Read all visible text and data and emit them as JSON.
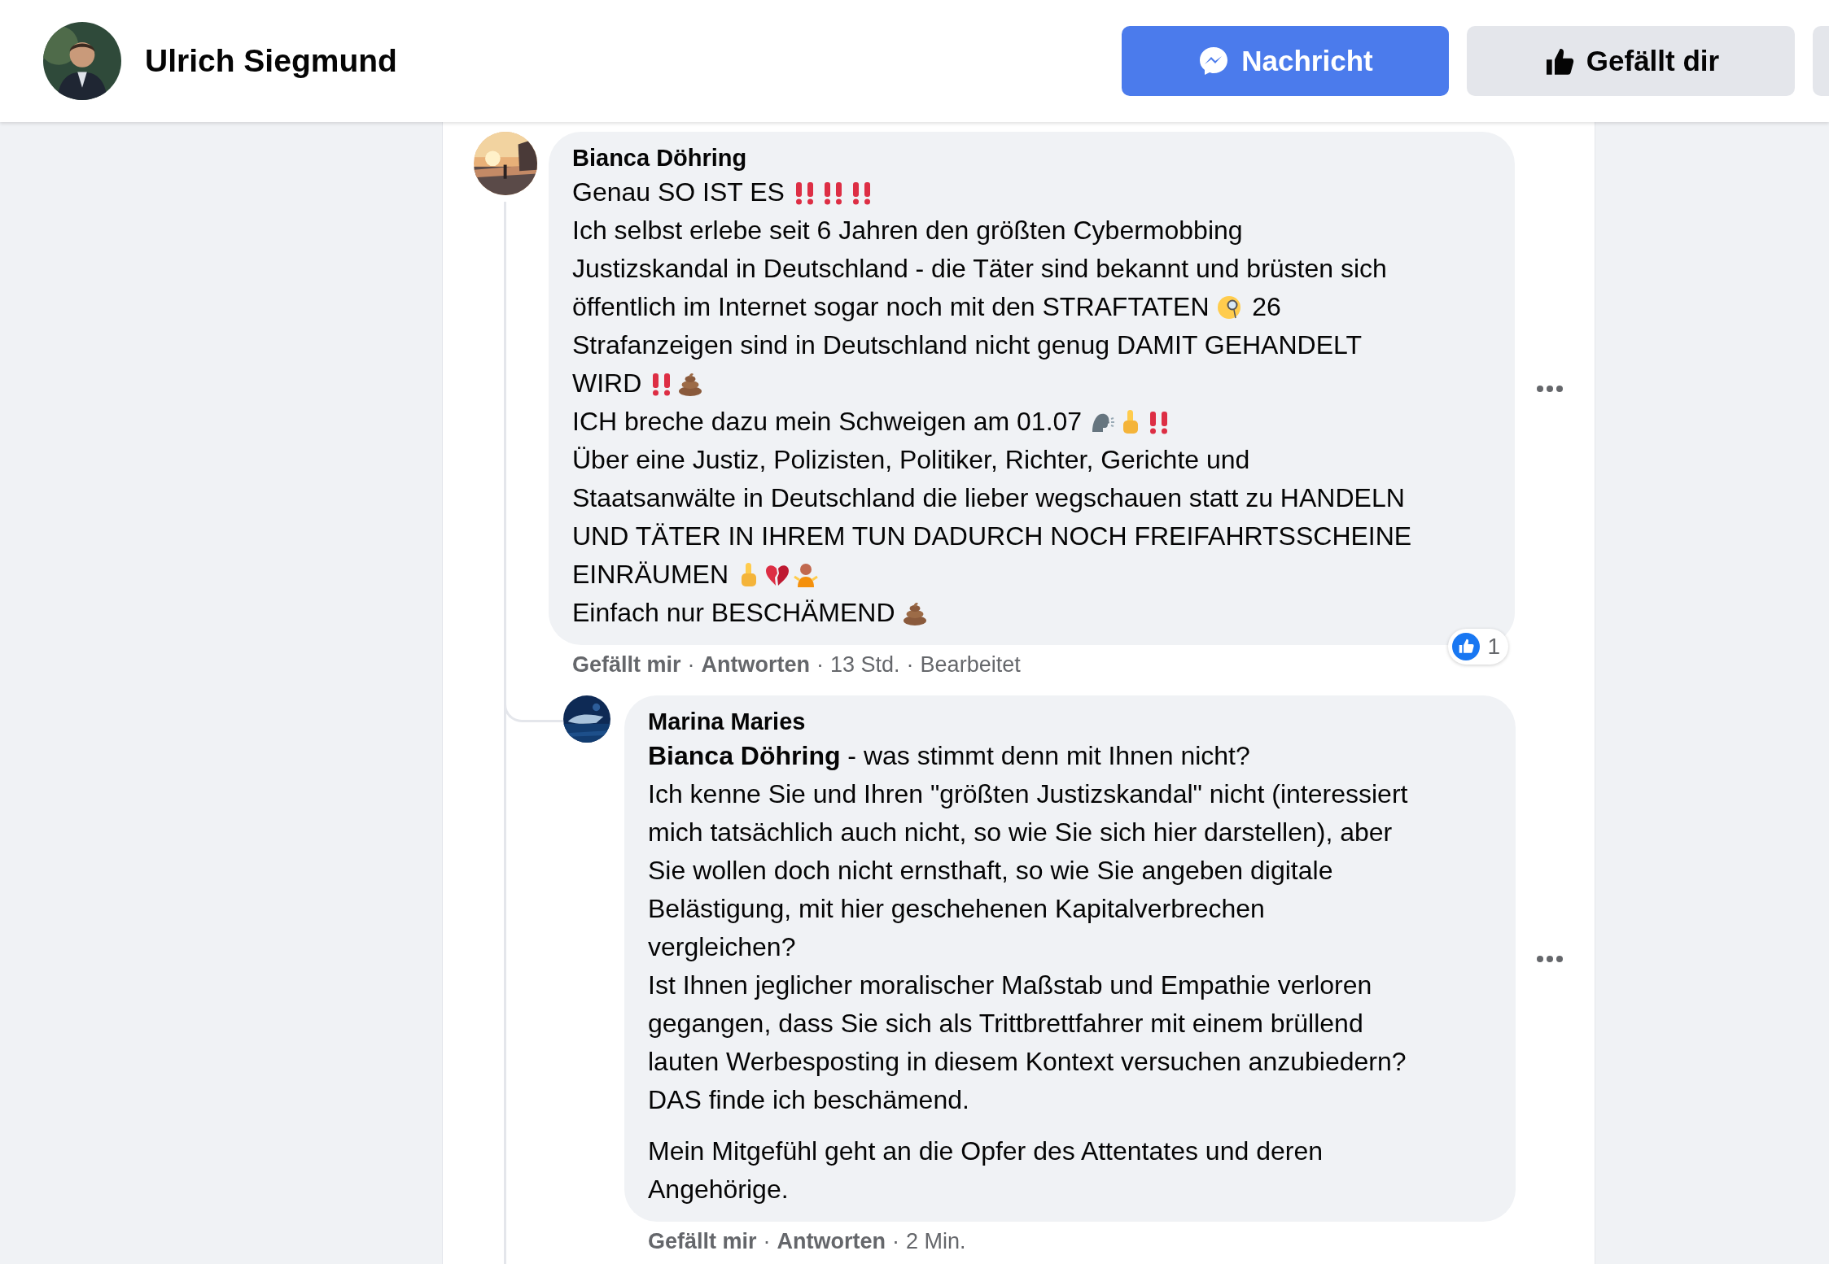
{
  "header": {
    "page_name": "Ulrich Siegmund",
    "buttons": [
      {
        "kind": "message",
        "label": "Nachricht"
      },
      {
        "kind": "like",
        "label": "Gefällt dir"
      }
    ]
  },
  "comments": [
    {
      "author": "Bianca Döhring",
      "paragraphs": [
        [
          [
            {
              "kind": "text",
              "text": "Genau SO IST ES "
            },
            {
              "kind": "bangs"
            },
            {
              "kind": "bangs"
            },
            {
              "kind": "bangs"
            }
          ],
          [
            {
              "kind": "text",
              "text": "Ich selbst erlebe seit 6 Jahren den größten Cybermobbing"
            }
          ],
          [
            {
              "kind": "text",
              "text": "Justizskandal in Deutschland - die Täter sind bekannt und brüsten sich"
            }
          ],
          [
            {
              "kind": "text",
              "text": "öffentlich im Internet sogar noch mit den STRAFTATEN "
            },
            {
              "kind": "monocle"
            },
            {
              "kind": "text",
              "text": " 26"
            }
          ],
          [
            {
              "kind": "text",
              "text": "Strafanzeigen sind in Deutschland nicht genug DAMIT GEHANDELT"
            }
          ],
          [
            {
              "kind": "text",
              "text": "WIRD "
            },
            {
              "kind": "bangs"
            },
            {
              "kind": "poop"
            }
          ],
          [
            {
              "kind": "text",
              "text": "ICH breche dazu mein Schweigen am 01.07 "
            },
            {
              "kind": "speaking"
            },
            {
              "kind": "finger"
            },
            {
              "kind": "bangs"
            }
          ],
          [
            {
              "kind": "text",
              "text": "Über eine Justiz, Polizisten, Politiker, Richter, Gerichte und"
            }
          ],
          [
            {
              "kind": "text",
              "text": "Staatsanwälte in Deutschland die lieber wegschauen statt zu HANDELN"
            }
          ],
          [
            {
              "kind": "text",
              "text": "UND TÄTER IN IHREM TUN DADURCH NOCH FREIFAHRTSSCHEINE"
            }
          ],
          [
            {
              "kind": "text",
              "text": "EINRÄUMEN "
            },
            {
              "kind": "finger"
            },
            {
              "kind": "heartbreak"
            },
            {
              "kind": "shrug"
            }
          ],
          [
            {
              "kind": "text",
              "text": "Einfach nur BESCHÄMEND "
            },
            {
              "kind": "poop"
            }
          ]
        ]
      ],
      "footer": [
        {
          "kind": "link",
          "text": "Gefällt mir"
        },
        {
          "kind": "text",
          "text": "·"
        },
        {
          "kind": "link",
          "text": "Antworten"
        },
        {
          "kind": "text",
          "text": "·"
        },
        {
          "kind": "text",
          "text": "13 Std."
        },
        {
          "kind": "text",
          "text": "·"
        },
        {
          "kind": "text",
          "text": "Bearbeitet"
        }
      ],
      "reactions": {
        "count": "1"
      },
      "replies": [
        {
          "author": "Marina Maries",
          "paragraphs": [
            [
              [
                {
                  "kind": "mention",
                  "text": "Bianca Döhring"
                },
                {
                  "kind": "text",
                  "text": " - was stimmt denn mit Ihnen nicht?"
                }
              ],
              [
                {
                  "kind": "text",
                  "text": "Ich kenne Sie und Ihren \"größten Justizskandal\" nicht (interessiert"
                }
              ],
              [
                {
                  "kind": "text",
                  "text": "mich tatsächlich auch nicht, so wie Sie sich hier darstellen), aber"
                }
              ],
              [
                {
                  "kind": "text",
                  "text": "Sie wollen doch nicht ernsthaft, so wie Sie angeben digitale"
                }
              ],
              [
                {
                  "kind": "text",
                  "text": "Belästigung, mit hier geschehenen Kapitalverbrechen"
                }
              ],
              [
                {
                  "kind": "text",
                  "text": "vergleichen?"
                }
              ],
              [
                {
                  "kind": "text",
                  "text": "Ist Ihnen jeglicher moralischer Maßstab und Empathie verloren"
                }
              ],
              [
                {
                  "kind": "text",
                  "text": "gegangen, dass Sie sich als Trittbrettfahrer mit einem brüllend"
                }
              ],
              [
                {
                  "kind": "text",
                  "text": "lauten Werbesposting in diesem Kontext versuchen anzubiedern?"
                }
              ],
              [
                {
                  "kind": "text",
                  "text": "DAS finde ich beschämend."
                }
              ]
            ],
            [
              [
                {
                  "kind": "text",
                  "text": "Mein Mitgefühl geht an die Opfer des Attentates und deren"
                }
              ],
              [
                {
                  "kind": "text",
                  "text": "Angehörige."
                }
              ]
            ]
          ],
          "footer": [
            {
              "kind": "link",
              "text": "Gefällt mir"
            },
            {
              "kind": "text",
              "text": "·"
            },
            {
              "kind": "link",
              "text": "Antworten"
            },
            {
              "kind": "text",
              "text": "·"
            },
            {
              "kind": "text",
              "text": "2 Min."
            }
          ]
        }
      ]
    }
  ]
}
